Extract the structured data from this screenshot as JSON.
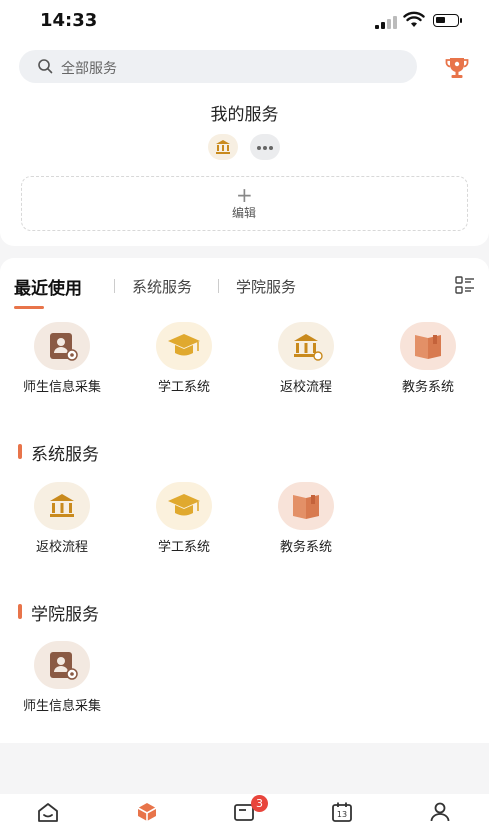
{
  "status_bar": {
    "time": "14:33"
  },
  "search": {
    "placeholder": "全部服务"
  },
  "my_services": {
    "title": "我的服务",
    "edit_label": "编辑"
  },
  "tabs": [
    {
      "label": "最近使用",
      "active": true
    },
    {
      "label": "系统服务",
      "active": false
    },
    {
      "label": "学院服务",
      "active": false
    }
  ],
  "recent": [
    {
      "label": "师生信息采集",
      "icon": "id-card-icon"
    },
    {
      "label": "学工系统",
      "icon": "graduation-cap-icon"
    },
    {
      "label": "返校流程",
      "icon": "institution-icon"
    },
    {
      "label": "教务系统",
      "icon": "book-icon"
    }
  ],
  "system_services": {
    "title": "系统服务",
    "items": [
      {
        "label": "返校流程",
        "icon": "institution-icon"
      },
      {
        "label": "学工系统",
        "icon": "graduation-cap-icon"
      },
      {
        "label": "教务系统",
        "icon": "book-icon"
      }
    ]
  },
  "college_services": {
    "title": "学院服务",
    "items": [
      {
        "label": "师生信息采集",
        "icon": "id-card-icon"
      }
    ]
  },
  "bottom_nav": {
    "badge": "3",
    "active_index": 1
  },
  "colors": {
    "accent": "#e8744a",
    "badge": "#e8453c",
    "gold": "#e0a92e"
  }
}
